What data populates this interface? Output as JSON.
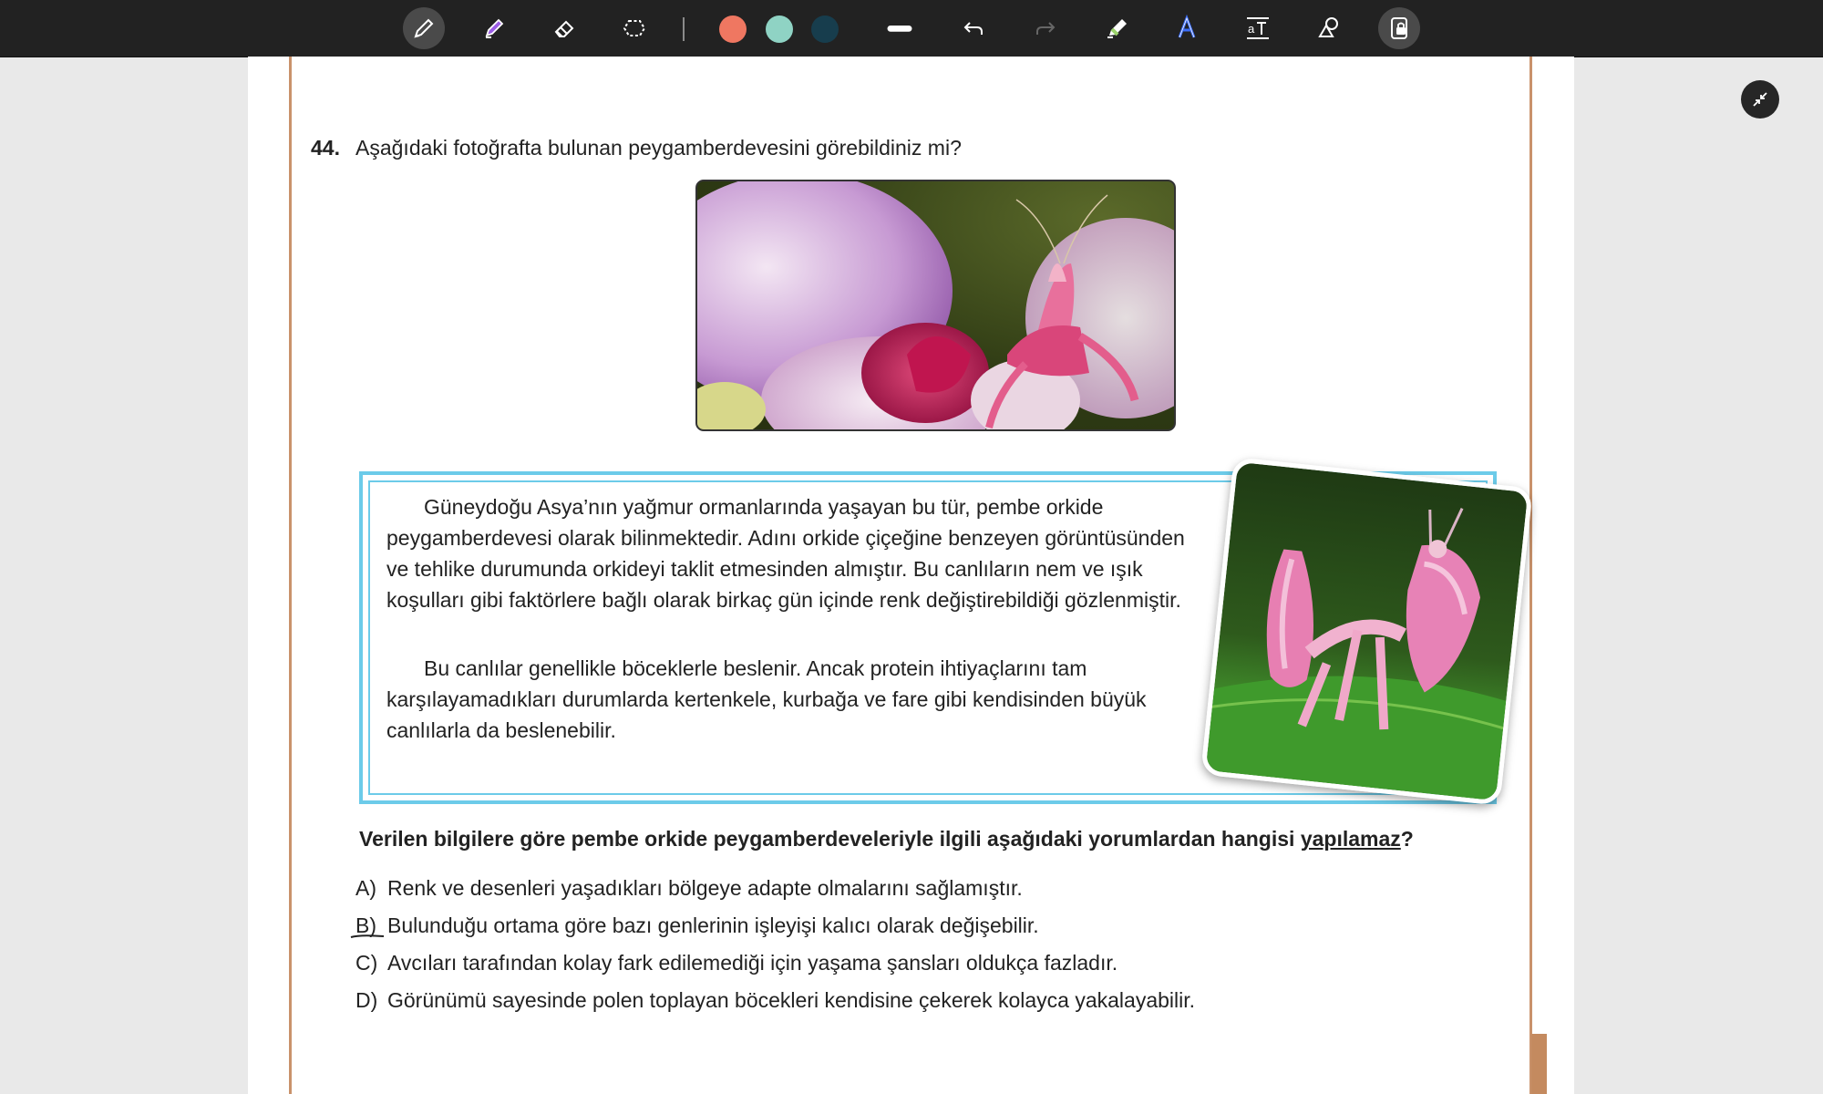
{
  "toolbar": {
    "tools": [
      {
        "name": "pen",
        "icon": "pen-icon",
        "active": true
      },
      {
        "name": "highlighter",
        "icon": "highlighter-icon"
      },
      {
        "name": "eraser",
        "icon": "eraser-icon"
      },
      {
        "name": "lasso",
        "icon": "lasso-icon"
      }
    ],
    "colors": [
      "#ef7761",
      "#8fd3c4",
      "#173d4d"
    ],
    "right_tools": [
      "stroke-width-icon",
      "undo-icon",
      "redo-icon",
      "marker-icon",
      "text-style-icon",
      "text-size-icon",
      "shapes-icon",
      "lock-icon"
    ]
  },
  "question": {
    "number": "44.",
    "text": "Aşağıdaki fotoğrafta bulunan peygamberdevesini görebildiniz mi?",
    "info_p1": "Güneydoğu Asya’nın yağmur ormanlarında yaşayan bu tür, pembe orkide peygamberdevesi olarak bilinmektedir. Adını orkide çiçeğine benzeyen görüntüsünden ve tehlike durumunda orkideyi taklit etmesinden almıştır. Bu canlıların nem ve ışık koşulları gibi faktörlere bağlı olarak birkaç gün içinde renk değiştirebildiği gözlenmiştir.",
    "info_p2": "Bu canlılar genellikle böceklerle beslenir. Ancak protein ihtiyaçlarını tam karşılayamadıkları durumlarda kertenkele, kurbağa ve fare gibi kendisinden büyük canlılarla da beslenebilir.",
    "prompt_main": "Verilen bilgilere göre pembe orkide peygamberdeveleriyle ilgili aşağıdaki yorumlardan hangisi ",
    "prompt_emph": "yapılamaz",
    "prompt_end": "?",
    "options": [
      {
        "letter": "A)",
        "text": "Renk ve desenleri yaşadıkları bölgeye adapte olmalarını sağlamıştır."
      },
      {
        "letter": "B)",
        "text": "Bulunduğu ortama göre bazı genlerinin işleyişi kalıcı olarak değişebilir."
      },
      {
        "letter": "C)",
        "text": "Avcıları tarafından kolay fark edilemediği için yaşama şansları oldukça fazladır."
      },
      {
        "letter": "D)",
        "text": "Görünümü sayesinde polen toplayan böcekleri kendisine çekerek kolayca yakalayabilir."
      }
    ]
  },
  "accent_colors": {
    "frame": "#c9926b",
    "info_border": "#6ccbe9"
  }
}
